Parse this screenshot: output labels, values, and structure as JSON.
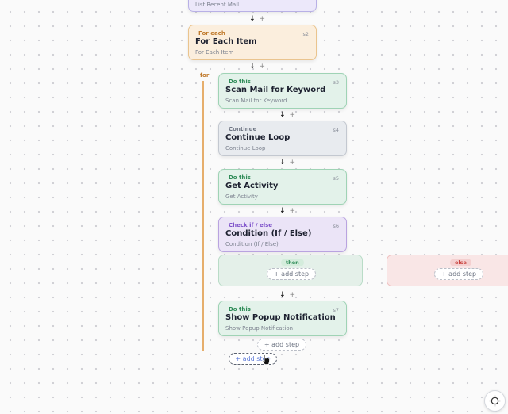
{
  "colors": {
    "do_this": "#2e8b57",
    "for_each": "#c07a2c",
    "continue": "#6b7280",
    "check_if_else": "#7c4fc9",
    "for_line": "#e0a15a",
    "else": "#d9534f"
  },
  "top_card": {
    "subtitle": "List Recent Mail"
  },
  "steps": [
    {
      "tag": "For each",
      "id": "s2",
      "title": "For Each Item",
      "subtitle": "For Each Item"
    },
    {
      "tag": "Do this",
      "id": "s3",
      "title": "Scan Mail for Keyword",
      "subtitle": "Scan Mail for Keyword"
    },
    {
      "tag": "Continue",
      "id": "s4",
      "title": "Continue Loop",
      "subtitle": "Continue Loop"
    },
    {
      "tag": "Do this",
      "id": "s5",
      "title": "Get Activity",
      "subtitle": "Get Activity"
    },
    {
      "tag": "Check if / else",
      "id": "s6",
      "title": "Condition (If / Else)",
      "subtitle": "Condition (If / Else)"
    },
    {
      "tag": "Do this",
      "id": "s7",
      "title": "Show Popup Notification",
      "subtitle": "Show Popup Notification"
    }
  ],
  "loop_label": "for",
  "connector": {
    "arrow": "↓",
    "plus": "+"
  },
  "branches": {
    "then_label": "then",
    "else_label": "else"
  },
  "add_step_label": "+ add step",
  "icons": {
    "recenter": "crosshair-icon",
    "cursor": "pointer-cursor-icon"
  }
}
